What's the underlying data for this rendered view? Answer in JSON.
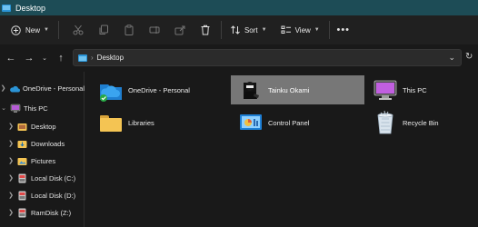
{
  "window": {
    "title": "Desktop"
  },
  "toolbar": {
    "new_label": "New",
    "sort_label": "Sort",
    "view_label": "View"
  },
  "address": {
    "crumbs": [
      "Desktop"
    ]
  },
  "sidebar": {
    "items": [
      {
        "label": "OneDrive - Personal",
        "icon": "cloud-icon"
      },
      {
        "label": "This PC",
        "icon": "computer-icon"
      },
      {
        "label": "Desktop",
        "icon": "desktop-folder-icon"
      },
      {
        "label": "Downloads",
        "icon": "downloads-folder-icon"
      },
      {
        "label": "Pictures",
        "icon": "pictures-folder-icon"
      },
      {
        "label": "Local Disk (C:)",
        "icon": "drive-icon"
      },
      {
        "label": "Local Disk (D:)",
        "icon": "drive-icon"
      },
      {
        "label": "RamDisk (Z:)",
        "icon": "drive-icon"
      }
    ]
  },
  "content": {
    "items": [
      {
        "label": "OneDrive - Personal",
        "icon": "onedrive-cloud-icon",
        "selected": false
      },
      {
        "label": "Tainku Okami",
        "icon": "user-folder-icon",
        "selected": true
      },
      {
        "label": "This PC",
        "icon": "this-pc-icon",
        "selected": false
      },
      {
        "label": "Libraries",
        "icon": "libraries-folder-icon",
        "selected": false
      },
      {
        "label": "Control Panel",
        "icon": "control-panel-icon",
        "selected": false
      },
      {
        "label": "Recycle Bin",
        "icon": "recycle-bin-icon",
        "selected": false
      }
    ]
  },
  "colors": {
    "titlebar": "#1d4c56",
    "background": "#191919",
    "toolbar": "#202020",
    "selection": "#777777",
    "folder_yellow": "#f4c453",
    "accent_blue": "#2b94d6"
  }
}
